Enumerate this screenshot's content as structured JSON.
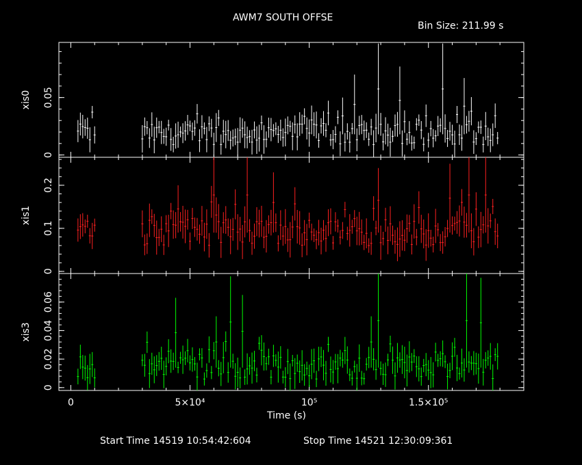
{
  "title": "AWM7 SOUTH OFFSE",
  "bin_size_label": "Bin Size: 211.99 s",
  "start_time_label": "Start Time 14519 10:54:42:604",
  "stop_time_label": "Stop Time 14521 12:30:09:361",
  "colors": {
    "xis0": "#ffffff",
    "xis1": "#ff2020",
    "xis3": "#00ff00",
    "axes": "#ffffff"
  },
  "chart_data": {
    "type": "line",
    "xlabel": "Time (s)",
    "xlim": [
      -5000,
      190000
    ],
    "x_ticks": [
      {
        "value": 0,
        "label": "0"
      },
      {
        "value": 50000,
        "label": "5×10⁴"
      },
      {
        "value": 100000,
        "label": "10⁵"
      },
      {
        "value": 150000,
        "label": "1.5×10⁵"
      }
    ],
    "gaps": [
      [
        10000,
        30000
      ]
    ],
    "panels": [
      {
        "name": "xis0",
        "ylabel": "xis0",
        "ylim": [
          -0.002,
          0.098
        ],
        "y_ticks": [
          {
            "value": 0,
            "label": "0"
          },
          {
            "value": 0.05,
            "label": "0.05"
          }
        ],
        "baseline": 0.018,
        "spread": 0.009,
        "spikes": [
          [
            128500,
            0.097
          ],
          [
            155500,
            0.097
          ],
          [
            118500,
            0.07
          ],
          [
            137500,
            0.077
          ],
          [
            165000,
            0.067
          ],
          [
            113500,
            0.05
          ],
          [
            100500,
            0.043
          ]
        ]
      },
      {
        "name": "xis1",
        "ylabel": "xis1",
        "ylim": [
          -0.005,
          0.265
        ],
        "y_ticks": [
          {
            "value": 0,
            "label": "0"
          },
          {
            "value": 0.1,
            "label": "0.1"
          },
          {
            "value": 0.2,
            "label": "0.2"
          }
        ],
        "baseline": 0.09,
        "spread": 0.03,
        "spikes": [
          [
            60000,
            0.265
          ],
          [
            73500,
            0.265
          ],
          [
            167000,
            0.265
          ],
          [
            174000,
            0.265
          ],
          [
            85000,
            0.23
          ],
          [
            128500,
            0.24
          ],
          [
            158500,
            0.25
          ],
          [
            45000,
            0.2
          ]
        ]
      },
      {
        "name": "xis3",
        "ylabel": "xis3",
        "ylim": [
          -0.002,
          0.08
        ],
        "y_ticks": [
          {
            "value": 0,
            "label": "0"
          },
          {
            "value": 0.02,
            "label": "0.02"
          },
          {
            "value": 0.04,
            "label": "0.04"
          },
          {
            "value": 0.06,
            "label": "0.06"
          }
        ],
        "baseline": 0.014,
        "spread": 0.008,
        "spikes": [
          [
            67000,
            0.078
          ],
          [
            128500,
            0.08
          ],
          [
            166000,
            0.08
          ],
          [
            172000,
            0.077
          ],
          [
            71500,
            0.065
          ],
          [
            44000,
            0.063
          ],
          [
            125500,
            0.05
          ],
          [
            60500,
            0.05
          ]
        ]
      }
    ]
  }
}
